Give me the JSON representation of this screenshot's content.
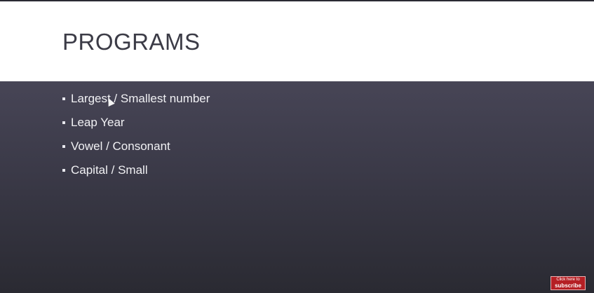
{
  "slide": {
    "title": "PROGRAMS",
    "bullets": [
      "Largest / Smallest number",
      "Leap Year",
      "Vowel / Consonant",
      "Capital / Small"
    ]
  },
  "subscribe_badge": {
    "line1": "Click here to",
    "line2": "subscribe"
  },
  "colors": {
    "header_background": "#ffffff",
    "title_text": "#3b3b46",
    "body_background": "#3a3947",
    "bullet_text": "#f1f1f4",
    "subscribe_background": "#b51f24"
  }
}
